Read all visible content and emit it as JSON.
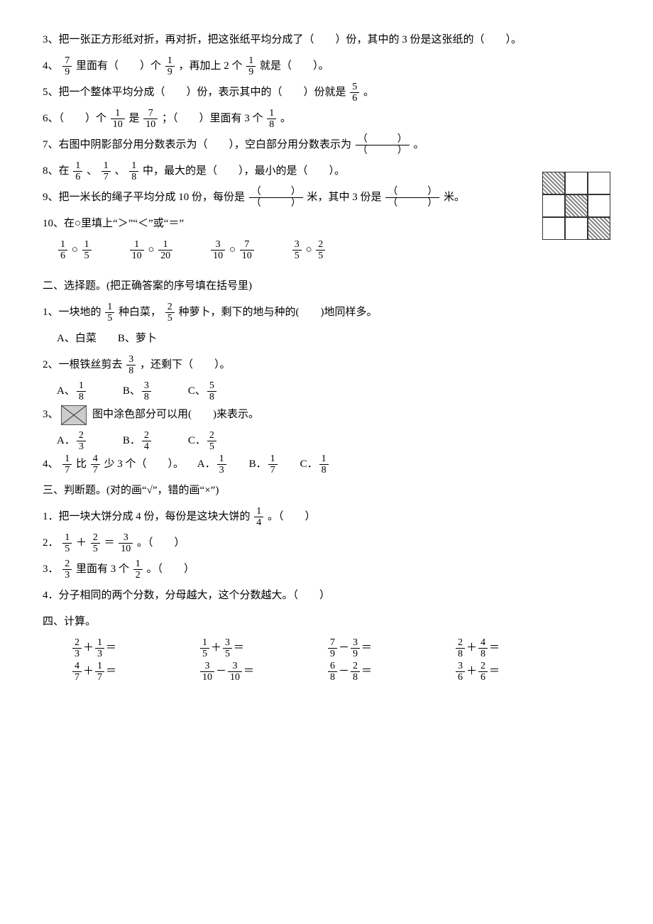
{
  "fill": {
    "q3": "3、把一张正方形纸对折，再对折，把这张纸平均分成了（　　）份，其中的 3 份是这张纸的（　　）。",
    "q4_a": "4、",
    "q4_b": "里面有（　　）个",
    "q4_c": "，再加上 2 个",
    "q4_d": "就是（　　）。",
    "q5_a": "5、把一个整体平均分成（　　）份，表示其中的（　　）份就是",
    "q5_b": "。",
    "q6_a": "6、（　　）个",
    "q6_b": "是",
    "q6_c": "；（　　）里面有 3 个",
    "q6_d": "。",
    "q7_a": "7、右图中阴影部分用分数表示为（　　），空白部分用分数表示为",
    "q7_b": "。",
    "q8_a": "8、在",
    "q8_b": "、",
    "q8_c": "、",
    "q8_d": "中，最大的是（　　），最小的是（　　）。",
    "q9_a": "9、把一米长的绳子平均分成 10 份，每份是",
    "q9_b": "米，其中 3 份是",
    "q9_c": "米。",
    "q10_head": "10、在○里填上“＞”“＜”或“＝”",
    "circle": "○"
  },
  "choice": {
    "heading": "二、选择题。(把正确答案的序号填在括号里)",
    "q1_a": "1、一块地的",
    "q1_b": "种白菜，",
    "q1_c": "种萝卜，剩下的地与种的(　　)地同样多。",
    "q1_opts": "A、白菜　　B、萝卜",
    "q2_a": "2、一根铁丝剪去",
    "q2_b": "，还剩下（　　）。",
    "q2_opt_a": "A、",
    "q2_opt_b": "B、",
    "q2_opt_c": "C、",
    "q3_a": "3、",
    "q3_b": "图中涂色部分可以用(　　)来表示。",
    "q3_opt_a": "A．",
    "q3_opt_b": "B．",
    "q3_opt_c": "C．",
    "q4_a": "4、",
    "q4_b": "比",
    "q4_c": "少 3 个（　　）。",
    "q4_opt_a": "A．",
    "q4_opt_b": "B．",
    "q4_opt_c": "C．"
  },
  "judge": {
    "heading": "三、判断题。(对的画“√”，错的画“×”)",
    "q1_a": "1．把一块大饼分成 4 份，每份是这块大饼的",
    "q1_b": "。（　　）",
    "q2_a": "2．",
    "q2_b": "＋",
    "q2_c": "＝",
    "q2_d": "。（　　）",
    "q3_a": "3．",
    "q3_b": "里面有 3 个",
    "q3_c": "。（　　）",
    "q4": "4．分子相同的两个分数，分母越大，这个分数越大。（　　）"
  },
  "calc": {
    "heading": "四、计算。",
    "plus": "＋",
    "minus": "－",
    "eq": "＝"
  },
  "fracs": {
    "f7_9": {
      "n": "7",
      "d": "9"
    },
    "f1_9": {
      "n": "1",
      "d": "9"
    },
    "f5_6": {
      "n": "5",
      "d": "6"
    },
    "f1_10": {
      "n": "1",
      "d": "10"
    },
    "f7_10": {
      "n": "7",
      "d": "10"
    },
    "f1_8": {
      "n": "1",
      "d": "8"
    },
    "f1_6": {
      "n": "1",
      "d": "6"
    },
    "f1_7": {
      "n": "1",
      "d": "7"
    },
    "f1_5": {
      "n": "1",
      "d": "5"
    },
    "f1_20": {
      "n": "1",
      "d": "20"
    },
    "f3_10": {
      "n": "3",
      "d": "10"
    },
    "f3_5": {
      "n": "3",
      "d": "5"
    },
    "f2_5": {
      "n": "2",
      "d": "5"
    },
    "f3_8": {
      "n": "3",
      "d": "8"
    },
    "f5_8": {
      "n": "5",
      "d": "8"
    },
    "f2_3": {
      "n": "2",
      "d": "3"
    },
    "f2_4": {
      "n": "2",
      "d": "4"
    },
    "f4_7": {
      "n": "4",
      "d": "7"
    },
    "f1_3": {
      "n": "1",
      "d": "3"
    },
    "f1_4": {
      "n": "1",
      "d": "4"
    },
    "f1_2": {
      "n": "1",
      "d": "2"
    },
    "f7_9b": {
      "n": "7",
      "d": "9"
    },
    "f3_9": {
      "n": "3",
      "d": "9"
    },
    "f2_8": {
      "n": "2",
      "d": "8"
    },
    "f4_8": {
      "n": "4",
      "d": "8"
    },
    "f6_8": {
      "n": "6",
      "d": "8"
    },
    "f3_6": {
      "n": "3",
      "d": "6"
    },
    "f2_6": {
      "n": "2",
      "d": "6"
    },
    "blank_paren": {
      "n": "（　　　）",
      "d": "（　　　）"
    }
  }
}
